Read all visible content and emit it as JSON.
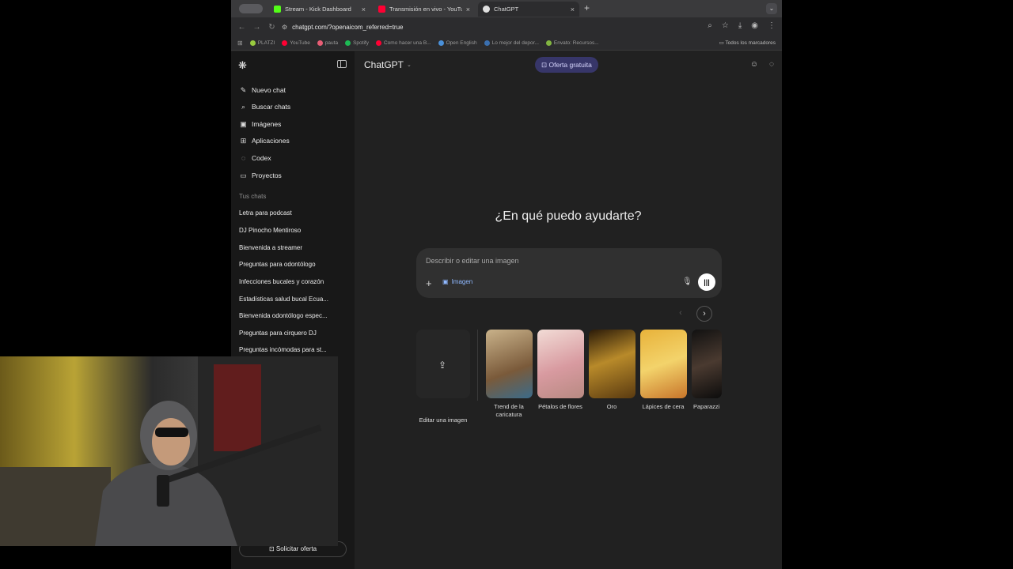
{
  "tabs": [
    {
      "label": "Stream - Kick Dashboard",
      "icon": "kick-icon",
      "color": "#53fc18",
      "active": false
    },
    {
      "label": "Transmisión en vivo - YouTub",
      "icon": "youtube-icon",
      "color": "#ff0033",
      "active": false
    },
    {
      "label": "ChatGPT",
      "icon": "chatgpt-icon",
      "color": "#e0e0e0",
      "active": true
    }
  ],
  "url": "chatgpt.com/?openaicom_referred=true",
  "bookmarks": [
    {
      "label": "PLATZI",
      "color": "#98ca3f"
    },
    {
      "label": "YouTube",
      "color": "#ff0033"
    },
    {
      "label": "pauta",
      "color": "#e85d75"
    },
    {
      "label": "Spotify",
      "color": "#1db954"
    },
    {
      "label": "Como hacer una B...",
      "color": "#ff0033"
    },
    {
      "label": "Open English",
      "color": "#4a90d9"
    },
    {
      "label": "Lo mejor del depor...",
      "color": "#3a6fb0"
    },
    {
      "label": "Envato: Recursos...",
      "color": "#82b541"
    }
  ],
  "bookmarks_all": "Todos los marcadores",
  "sidebar": {
    "nav": [
      {
        "label": "Nuevo chat",
        "icon": "new-chat-icon",
        "glyph": "✎"
      },
      {
        "label": "Buscar chats",
        "icon": "search-icon",
        "glyph": "⌕"
      },
      {
        "label": "Imágenes",
        "icon": "images-icon",
        "glyph": "▣"
      },
      {
        "label": "Aplicaciones",
        "icon": "apps-icon",
        "glyph": "⊞"
      },
      {
        "label": "Codex",
        "icon": "codex-icon",
        "glyph": "◌"
      },
      {
        "label": "Proyectos",
        "icon": "folder-icon",
        "glyph": "▭"
      }
    ],
    "section_title": "Tus chats",
    "chats": [
      "Letra para podcast",
      "DJ Pinocho Mentiroso",
      "Bienvenida a streamer",
      "Preguntas para odontólogo",
      "Infecciones bucales y corazón",
      "Estadísticas salud bucal Ecua...",
      "Bienvenida odontólogo espec...",
      "Preguntas para cirquero DJ",
      "Preguntas incómodas para st..."
    ],
    "offer_button": "Solicitar oferta"
  },
  "header": {
    "model": "ChatGPT",
    "promo": "Oferta gratuita"
  },
  "main": {
    "headline": "¿En qué puedo ayudarte?",
    "placeholder": "Describir o editar una imagen",
    "chip": "Imagen",
    "upload_label": "Editar una imagen",
    "cards": [
      {
        "label": "Trend de la caricatura",
        "bg": "linear-gradient(160deg,#c9b28a,#7a5a3a 60%,#3b6b8a)"
      },
      {
        "label": "Pétalos de flores",
        "bg": "linear-gradient(160deg,#f2dcd6,#d89aa0 55%,#b88a82)"
      },
      {
        "label": "Oro",
        "bg": "linear-gradient(160deg,#2a1a08,#b88a2a 45%,#5a3a10)"
      },
      {
        "label": "Lápices de cera",
        "bg": "linear-gradient(160deg,#e8b23a,#f3d36b 50%,#c8752a)"
      },
      {
        "label": "Paparazzi",
        "bg": "linear-gradient(160deg,#111,#4a3a30 50%,#0c0c0c)"
      }
    ]
  }
}
